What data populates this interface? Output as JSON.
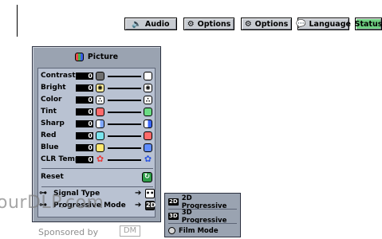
{
  "tabs": [
    {
      "label": "Audio",
      "icon": "speaker-icon"
    },
    {
      "label": "Options",
      "icon": "gear-icon"
    },
    {
      "label": "Options",
      "icon": "gear-icon"
    },
    {
      "label": "Language",
      "icon": "speech-bubble-icon"
    },
    {
      "label": "Status",
      "icon": "status-icon",
      "active": true
    }
  ],
  "panel": {
    "title": "Picture",
    "rows": [
      {
        "label": "Contrast",
        "value": "0"
      },
      {
        "label": "Bright",
        "value": "0"
      },
      {
        "label": "Color",
        "value": "0"
      },
      {
        "label": "Tint",
        "value": "0"
      },
      {
        "label": "Sharp",
        "value": "0"
      },
      {
        "label": "Red",
        "value": "0"
      },
      {
        "label": "Blue",
        "value": "0"
      },
      {
        "label": "CLR Temp",
        "value": "0"
      }
    ],
    "reset_label": "Reset",
    "signal_type_label": "Signal Type",
    "progressive_mode_label": "Progressive Mode"
  },
  "submenu": {
    "items": [
      {
        "badge": "2D",
        "label": "2D Progressive"
      },
      {
        "badge": "3D",
        "label": "3D Progressive"
      },
      {
        "badge": "",
        "label": "Film Mode"
      }
    ]
  },
  "watermark": {
    "text": "ourDLP.com",
    "sponsored": "Sponsored by",
    "logo": "DM"
  },
  "colors": {
    "panel": "#9aa3b1",
    "panel_body": "#b9c2d2",
    "active_tab": "#6fd082",
    "reset": "#2e9c48"
  }
}
